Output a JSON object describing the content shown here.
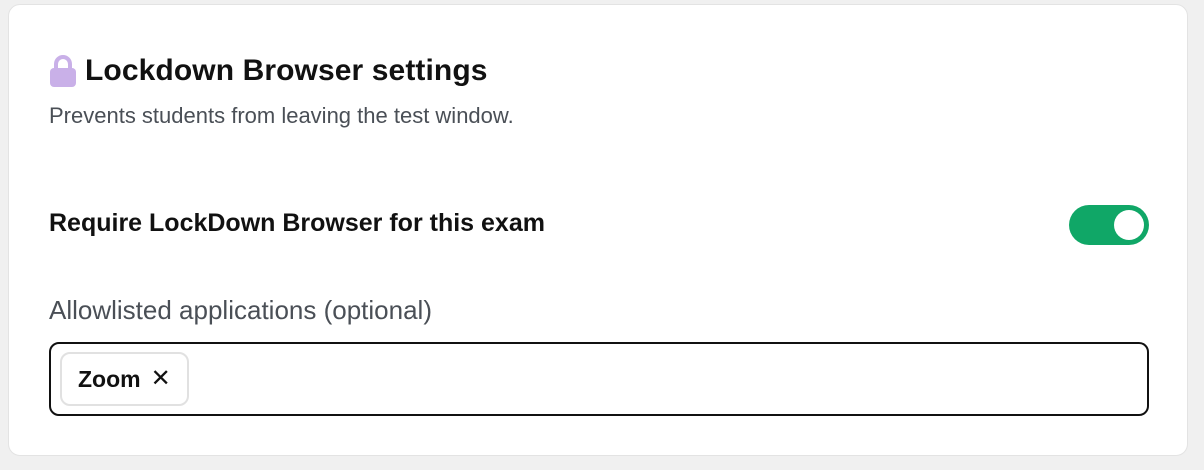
{
  "section": {
    "title": "Lockdown Browser settings",
    "subtitle": "Prevents students from leaving the test window.",
    "icon": "lock-icon",
    "icon_color": "#c9b0e8"
  },
  "require_lockdown": {
    "label": "Require LockDown Browser for this exam",
    "enabled": true,
    "toggle_color": "#10a767"
  },
  "allowlist": {
    "label": "Allowlisted applications (optional)",
    "chips": [
      {
        "label": "Zoom",
        "remove_glyph": "✕"
      }
    ]
  }
}
